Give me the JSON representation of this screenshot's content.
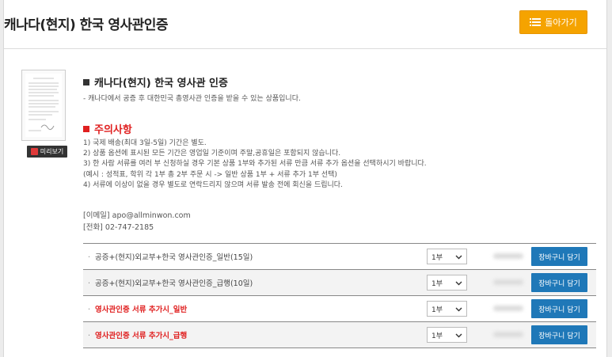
{
  "header": {
    "title": "캐나다(현지) 한국 영사관인증",
    "back_label": "돌아가기"
  },
  "preview": {
    "label": "미리보기"
  },
  "product": {
    "title": "캐나다(현지) 한국 영사관 인증",
    "desc": "- 캐나다에서 공증 후 대한민국 총영사관 인증을 받을 수 있는 상품입니다."
  },
  "notice": {
    "title": "주의사항",
    "items": [
      "1) 국제 배송(최대 3일-5일) 기간은 별도.",
      "2) 상품 옵션에 표시된 모든 기간은 영업일 기준이며 주말,공휴일은 포함되지 않습니다.",
      "3) 한 사람 서류를 여러 부 신청하실 경우 기본 상품 1부와 추가된 서류 만큼 서류 추가 옵션을 선택하시기 바랍니다.",
      "(예시 : 성적표, 학위 각 1부 총 2부 주문 시 -> 일반 상품 1부 + 서류 추가 1부 선택)",
      "4) 서류에 이상이 없을 경우 별도로 연락드리지 않으며 서류 발송 전에 회신을 드립니다."
    ]
  },
  "contact": {
    "email": "[이메일] apo@allminwon.com",
    "phone": "[전화] 02-747-2185"
  },
  "options": [
    {
      "name": "공증+(현지)외교부+한국 영사관인증_일반(15일)",
      "qty": "1부",
      "cart": "장바구니 담기",
      "highlight": false
    },
    {
      "name": "공증+(현지)외교부+한국 영사관인증_급행(10일)",
      "qty": "1부",
      "cart": "장바구니 담기",
      "highlight": false
    },
    {
      "name": "영사관인증 서류 추가시_일반",
      "qty": "1부",
      "cart": "장바구니 담기",
      "highlight": true
    },
    {
      "name": "영사관인증 서류 추가시_급행",
      "qty": "1부",
      "cart": "장바구니 담기",
      "highlight": true
    }
  ],
  "colors": {
    "accent_orange": "#f5a300",
    "cart_blue": "#1f78b8",
    "notice_red": "#e02020"
  }
}
